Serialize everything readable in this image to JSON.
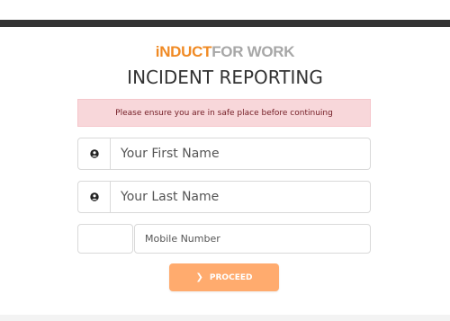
{
  "brand": {
    "logo_part1": "iNDUCT",
    "logo_part2": "FOR WORK",
    "accent_color": "#f08a24",
    "secondary_color": "#a7a7a7"
  },
  "header": {
    "title": "INCIDENT REPORTING"
  },
  "alert": {
    "message": "Please ensure you are in safe place before continuing",
    "background": "#f8d7da",
    "text_color": "#721c24"
  },
  "form": {
    "first_name": {
      "placeholder": "Your First Name",
      "value": "",
      "icon": "user-icon"
    },
    "last_name": {
      "placeholder": "Your Last Name",
      "value": "",
      "icon": "user-icon"
    },
    "mobile": {
      "country_code": "",
      "placeholder": "Mobile Number",
      "value": ""
    },
    "proceed": {
      "label": "PROCEED",
      "icon": "chevron-right-icon",
      "color": "#ffab6e"
    }
  }
}
